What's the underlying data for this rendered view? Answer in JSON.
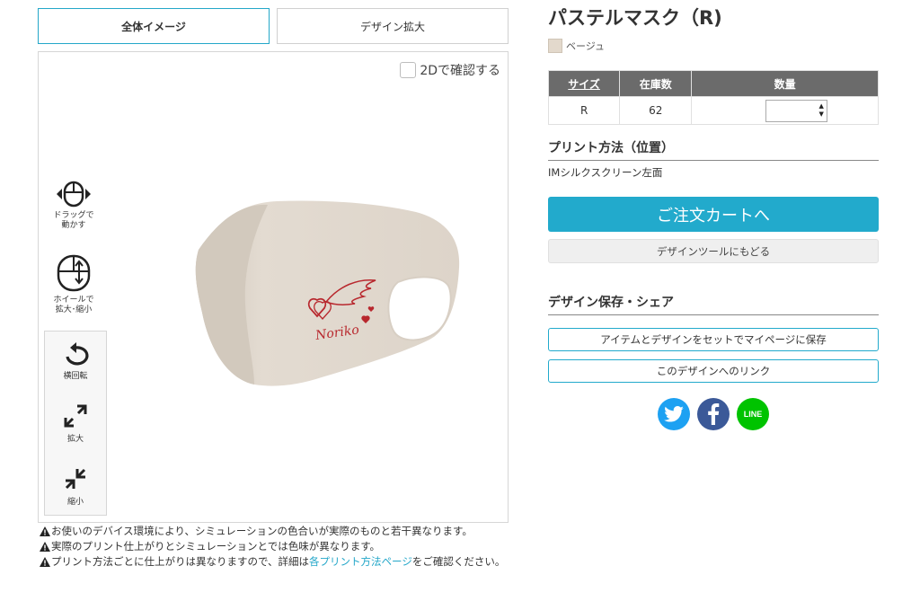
{
  "tabs": {
    "overall": "全体イメージ",
    "zoom": "デザイン拡大"
  },
  "viewer": {
    "check_2d": "2Dで確認する",
    "drag": {
      "line1": "ドラッグで",
      "line2": "動かす"
    },
    "wheel": {
      "line1": "ホイールで",
      "line2": "拡大･縮小"
    },
    "rotate": "横回転",
    "enlarge": "拡大",
    "shrink": "縮小",
    "print_name": "Noriko"
  },
  "notes": {
    "note1": "お使いのデバイス環境により、シミュレーションの色合いが実際のものと若干異なります。",
    "note2": "実際のプリント仕上がりとシミュレーションとでは色味が異なります。",
    "note3_before": "プリント方法ごとに仕上がりは異なりますので、詳細は",
    "note3_link": "各プリント方法ページ",
    "note3_after": "をご確認ください。"
  },
  "product": {
    "title": "パステルマスク（R)",
    "color_name": "ベージュ",
    "swatch_color": "#e3d9cc"
  },
  "stock_table": {
    "headers": {
      "size": "サイズ",
      "stock": "在庫数",
      "qty": "数量"
    },
    "rows": [
      {
        "size": "R",
        "stock": "62",
        "qty": ""
      }
    ]
  },
  "print_method": {
    "title": "プリント方法（位置）",
    "value": "IMシルクスクリーン左面"
  },
  "buttons": {
    "cart": "ご注文カートへ",
    "back": "デザインツールにもどる",
    "save": "アイテムとデザインをセットでマイページに保存",
    "link": "このデザインへのリンク"
  },
  "share": {
    "title": "デザイン保存・シェア",
    "line_label": "LINE"
  },
  "colors": {
    "accent": "#22aacc",
    "twitter": "#1da1f2",
    "facebook": "#3b5998",
    "line": "#00c300",
    "print": "#b8282e"
  }
}
